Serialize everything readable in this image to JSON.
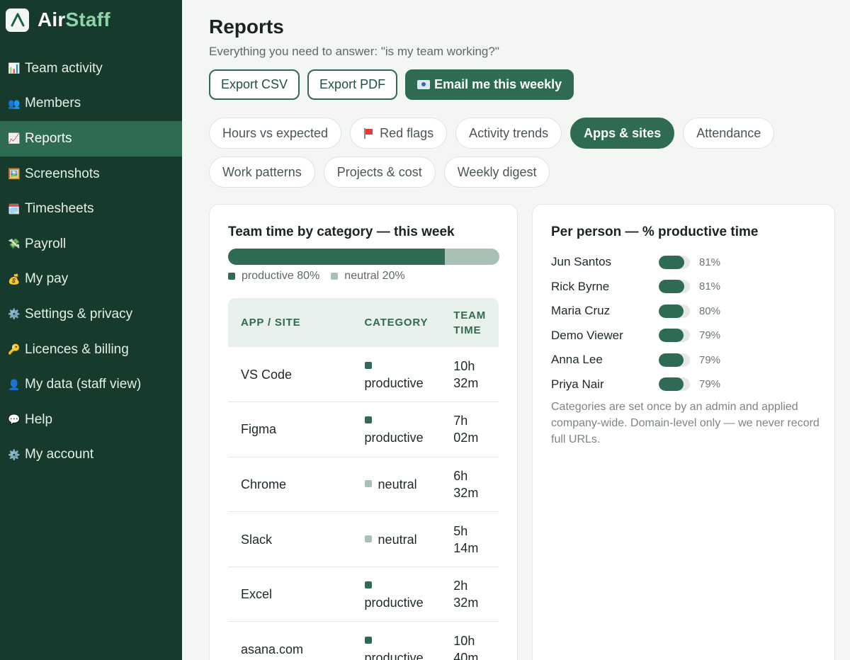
{
  "brand": {
    "name_part1": "Air",
    "name_part2": "Staff",
    "logo_icon": "airstaff-logo-icon"
  },
  "sidebar": {
    "items": [
      {
        "label": "Team activity",
        "icon": "📊",
        "icon_name": "bar-chart-icon"
      },
      {
        "label": "Members",
        "icon": "👥",
        "icon_name": "people-icon"
      },
      {
        "label": "Reports",
        "icon": "📈",
        "icon_name": "trend-chart-icon",
        "active": true
      },
      {
        "label": "Screenshots",
        "icon": "🖼️",
        "icon_name": "picture-icon"
      },
      {
        "label": "Timesheets",
        "icon": "🗓️",
        "icon_name": "calendar-icon"
      },
      {
        "label": "Payroll",
        "icon": "💸",
        "icon_name": "money-wings-icon"
      },
      {
        "label": "My pay",
        "icon": "💰",
        "icon_name": "money-bag-icon"
      },
      {
        "label": "Settings & privacy",
        "icon": "⚙️",
        "icon_name": "gear-icon"
      },
      {
        "label": "Licences & billing",
        "icon": "🔑",
        "icon_name": "key-icon"
      },
      {
        "label": "My data (staff view)",
        "icon": "👤",
        "icon_name": "person-icon"
      },
      {
        "label": "Help",
        "icon": "💬",
        "icon_name": "speech-bubble-icon"
      },
      {
        "label": "My account",
        "icon": "⚙️",
        "icon_name": "gear-icon"
      }
    ]
  },
  "header": {
    "title": "Reports",
    "subtitle": "Everything you need to answer: \"is my team working?\""
  },
  "actions": {
    "export_csv": "Export CSV",
    "export_pdf": "Export PDF",
    "email_weekly": "Email me this weekly"
  },
  "tabs": [
    {
      "label": "Hours vs expected"
    },
    {
      "label": "Red flags",
      "icon_name": "red-flag-icon"
    },
    {
      "label": "Activity trends"
    },
    {
      "label": "Apps & sites",
      "active": true
    },
    {
      "label": "Attendance"
    },
    {
      "label": "Work patterns"
    },
    {
      "label": "Projects & cost"
    },
    {
      "label": "Weekly digest"
    }
  ],
  "category_card": {
    "title": "Team time by category — this week",
    "productive_pct": 80,
    "neutral_pct": 20,
    "legend_productive": "productive 80%",
    "legend_neutral": "neutral 20%",
    "colors": {
      "productive": "#2e6b52",
      "neutral": "#a9c1b5"
    },
    "table": {
      "headers": {
        "app": "APP / SITE",
        "category": "CATEGORY",
        "time": "TEAM TIME"
      },
      "rows": [
        {
          "app": "VS Code",
          "category": "productive",
          "time": "10h 32m"
        },
        {
          "app": "Figma",
          "category": "productive",
          "time": "7h 02m"
        },
        {
          "app": "Chrome",
          "category": "neutral",
          "time": "6h 32m"
        },
        {
          "app": "Slack",
          "category": "neutral",
          "time": "5h 14m"
        },
        {
          "app": "Excel",
          "category": "productive",
          "time": "2h 32m"
        },
        {
          "app": "asana.com",
          "category": "productive",
          "time": "10h 40m"
        }
      ]
    }
  },
  "person_card": {
    "title": "Per person — % productive time",
    "people": [
      {
        "name": "Jun Santos",
        "pct": 81,
        "pct_label": "81%"
      },
      {
        "name": "Rick Byrne",
        "pct": 81,
        "pct_label": "81%"
      },
      {
        "name": "Maria Cruz",
        "pct": 80,
        "pct_label": "80%"
      },
      {
        "name": "Demo Viewer",
        "pct": 79,
        "pct_label": "79%"
      },
      {
        "name": "Anna Lee",
        "pct": 79,
        "pct_label": "79%"
      },
      {
        "name": "Priya Nair",
        "pct": 79,
        "pct_label": "79%"
      }
    ],
    "note": "Categories are set once by an admin and applied company-wide. Domain-level only — we never record full URLs."
  }
}
